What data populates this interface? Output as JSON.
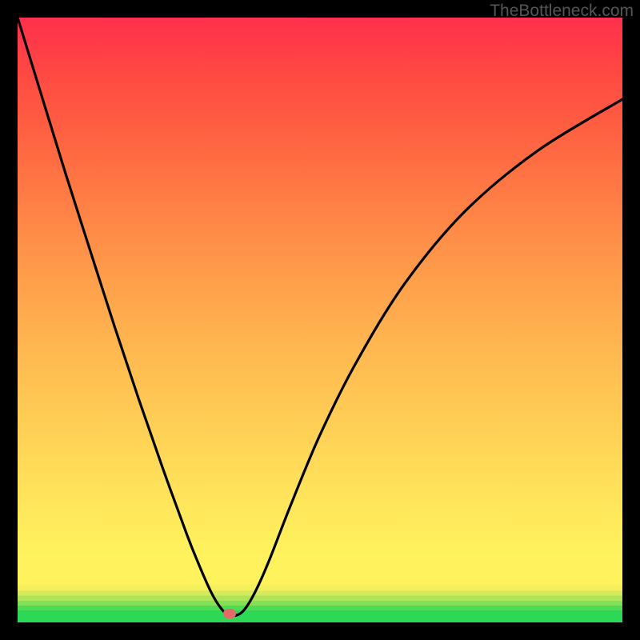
{
  "watermark": "TheBottleneck.com",
  "chart_data": {
    "type": "line",
    "title": "",
    "xlabel": "",
    "ylabel": "",
    "xlim": [
      0,
      100
    ],
    "ylim": [
      0,
      100
    ],
    "series": [
      {
        "name": "curve",
        "x": [
          0,
          4,
          8,
          12,
          16,
          20,
          24,
          28,
          30,
          32,
          33.5,
          35,
          37,
          39,
          41.5,
          45,
          50,
          56,
          64,
          74,
          86,
          100
        ],
        "values": [
          100,
          87,
          74,
          61.5,
          49,
          37,
          25.5,
          14.5,
          9.5,
          5,
          2.5,
          1.2,
          1.6,
          4.5,
          10,
          19,
          31,
          43,
          56,
          68,
          78,
          86.5
        ]
      }
    ],
    "marker": {
      "x": 35,
      "y": 1.4
    },
    "background": {
      "type": "vertical-gradient",
      "description": "Red at top through orange and yellow to yellow-green bands and green at bottom"
    }
  }
}
